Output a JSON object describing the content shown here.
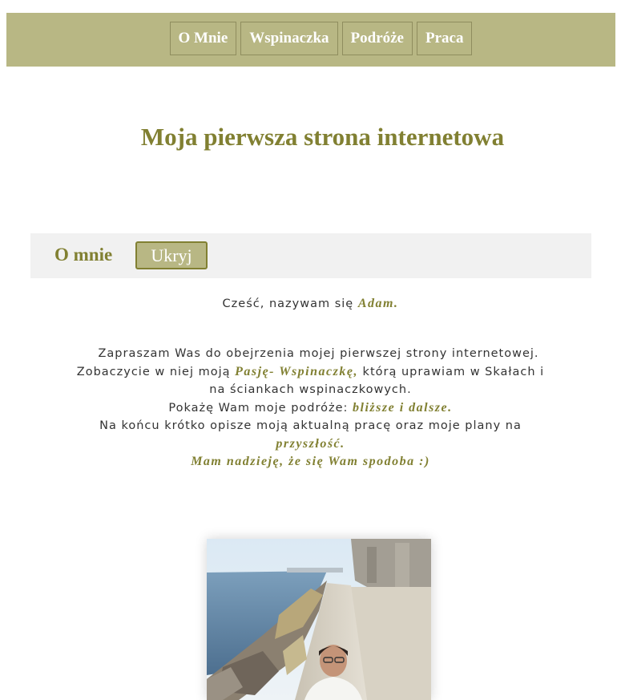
{
  "nav": {
    "items": [
      {
        "label": "O Mnie"
      },
      {
        "label": "Wspinaczka"
      },
      {
        "label": "Podróże"
      },
      {
        "label": "Praca"
      }
    ]
  },
  "header": {
    "title": "Moja pierwsza strona internetowa"
  },
  "about": {
    "heading": "O mnie",
    "toggle_label": "Ukryj",
    "greeting": {
      "text": "Cześć, nazywam się",
      "name": "Adam."
    },
    "paragraph": {
      "l1": "Zapraszam Was do obejrzenia mojej pierwszej strony internetowej.",
      "l2_a": "Zobaczycie w niej moją",
      "l2_em": "Pasję- Wspinaczkę,",
      "l2_b": "którą uprawiam w Skałach i",
      "l3": "na ściankach wspinaczkowych.",
      "l4_a": "Pokażę Wam moje podróże:",
      "l4_em": "bliższe i dalsze.",
      "l5": "Na końcu krótko opisze moją aktualną pracę oraz moje plany na",
      "l6_em": "przyszłość.",
      "l7_em": "Mam nadzieję, że się Wam spodoba :)"
    }
  },
  "colors": {
    "accent": "#b8b784",
    "accent_dark": "#818032",
    "section_bg": "#f1f1f1"
  },
  "image": {
    "subject": "seaside-portrait-photo"
  }
}
